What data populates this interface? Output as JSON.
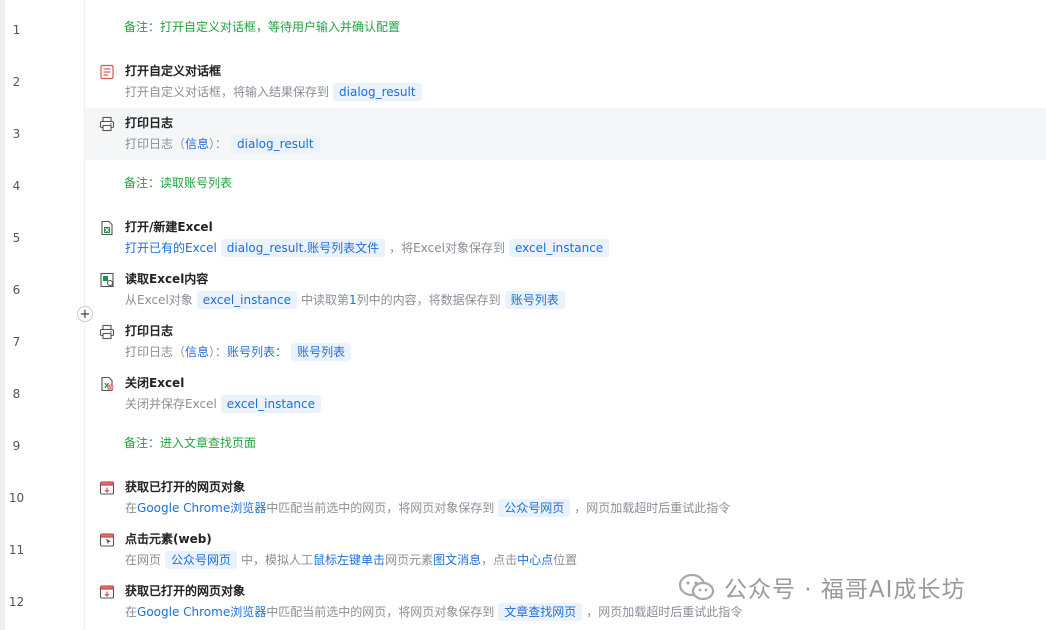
{
  "rows": [
    {
      "num": "1",
      "note": "备注：打开自定义对话框，等待用户输入并确认配置"
    },
    {
      "num": "2",
      "icon": "dialog-icon",
      "title": "打开自定义对话框",
      "desc": [
        {
          "t": "打开自定义对话框，将输入结果保存到"
        },
        {
          "chip": "dialog_result"
        }
      ]
    },
    {
      "num": "3",
      "icon": "print-log-icon",
      "title": "打印日志",
      "desc": [
        {
          "t": "打印日志（"
        },
        {
          "b": "信息"
        },
        {
          "t": "）："
        },
        {
          "chip": "dialog_result"
        }
      ]
    },
    {
      "num": "4",
      "note": "备注：读取账号列表"
    },
    {
      "num": "5",
      "icon": "excel-open-icon",
      "title": "打开/新建Excel",
      "desc": [
        {
          "b": "打开已有的Excel"
        },
        {
          "chip": "dialog_result.账号列表文件"
        },
        {
          "t": "，将Excel对象保存到"
        },
        {
          "chip": "excel_instance"
        }
      ]
    },
    {
      "num": "6",
      "icon": "excel-read-icon",
      "title": "读取Excel内容",
      "desc": [
        {
          "t": "从Excel对象"
        },
        {
          "chip": "excel_instance"
        },
        {
          "t": "中读取第"
        },
        {
          "b": "1"
        },
        {
          "t": "列中的内容，将数据保存到"
        },
        {
          "chip": "账号列表"
        }
      ]
    },
    {
      "num": "7",
      "icon": "print-log-icon",
      "title": "打印日志",
      "desc": [
        {
          "t": "打印日志（"
        },
        {
          "b": "信息"
        },
        {
          "t": "）："
        },
        {
          "b": "账号列表："
        },
        {
          "chip": "账号列表"
        }
      ]
    },
    {
      "num": "8",
      "icon": "excel-close-icon",
      "title": "关闭Excel",
      "desc": [
        {
          "t": "关闭并保存Excel"
        },
        {
          "chip": "excel_instance"
        }
      ]
    },
    {
      "num": "9",
      "note": "备注：进入文章查找页面"
    },
    {
      "num": "10",
      "icon": "browser-icon",
      "title": "获取已打开的网页对象",
      "desc": [
        {
          "t": "在"
        },
        {
          "b": "Google Chrome浏览器"
        },
        {
          "t": "中匹配当前选中的网页，将网页对象保存到"
        },
        {
          "chip": "公众号网页"
        },
        {
          "t": "，网页加载超时后重试此指令"
        }
      ]
    },
    {
      "num": "11",
      "icon": "click-element-icon",
      "title": "点击元素(web)",
      "desc": [
        {
          "t": "在网页"
        },
        {
          "chip": "公众号网页"
        },
        {
          "t": "中，模拟人工"
        },
        {
          "b": "鼠标左键单击"
        },
        {
          "t": "网页元素"
        },
        {
          "b": "图文消息"
        },
        {
          "t": "，点击"
        },
        {
          "b": "中心点"
        },
        {
          "t": "位置"
        }
      ]
    },
    {
      "num": "12",
      "icon": "browser-icon",
      "title": "获取已打开的网页对象",
      "desc": [
        {
          "t": "在"
        },
        {
          "b": "Google Chrome浏览器"
        },
        {
          "t": "中匹配当前选中的网页，将网页对象保存到"
        },
        {
          "chip": "文章查找网页"
        },
        {
          "t": "，网页加载超时后重试此指令"
        }
      ]
    }
  ],
  "highlighted_row": "3",
  "add_button_symbol": "+",
  "watermark": {
    "text": "公众号 · 福哥AI成长坊",
    "icon": "wechat-icon"
  },
  "colors": {
    "note": "#23a340",
    "link": "#1d6fd8",
    "chip_bg": "#eaf2fe",
    "desc": "#8a8f97"
  }
}
